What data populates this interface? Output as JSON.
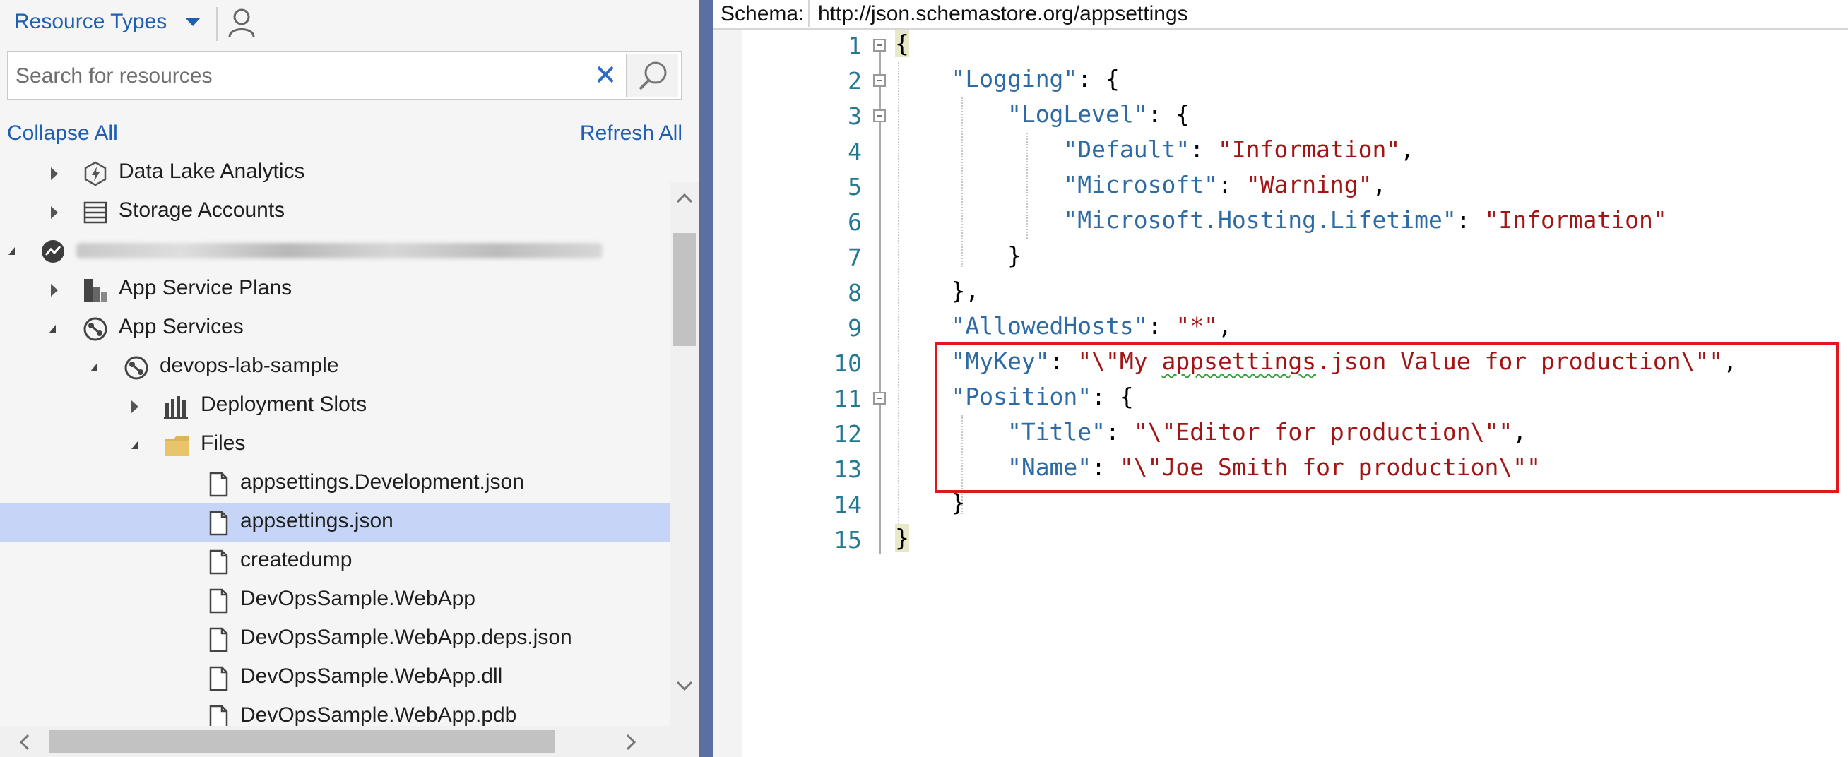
{
  "explorer": {
    "title": "Resource Types",
    "search_placeholder": "Search for resources",
    "collapse_all": "Collapse All",
    "refresh_all": "Refresh All",
    "tree": [
      {
        "label": "Data Lake Analytics",
        "icon": "data-lake-analytics-icon"
      },
      {
        "label": "Storage Accounts",
        "icon": "storage-accounts-icon"
      },
      {
        "label": "",
        "icon": "subscription-icon"
      },
      {
        "label": "App Service Plans",
        "icon": "app-service-plans-icon"
      },
      {
        "label": "App Services",
        "icon": "app-services-icon"
      },
      {
        "label": "devops-lab-sample",
        "icon": "web-app-icon"
      },
      {
        "label": "Deployment Slots",
        "icon": "deployment-slots-icon"
      },
      {
        "label": "Files",
        "icon": "folder-icon"
      },
      {
        "label": "appsettings.Development.json",
        "icon": "file-icon"
      },
      {
        "label": "appsettings.json",
        "icon": "file-icon",
        "selected": true
      },
      {
        "label": "createdump",
        "icon": "file-icon"
      },
      {
        "label": "DevOpsSample.WebApp",
        "icon": "file-icon"
      },
      {
        "label": "DevOpsSample.WebApp.deps.json",
        "icon": "file-icon"
      },
      {
        "label": "DevOpsSample.WebApp.dll",
        "icon": "file-icon"
      },
      {
        "label": "DevOpsSample.WebApp.pdb",
        "icon": "file-icon"
      }
    ]
  },
  "editor": {
    "schema_label": "Schema:",
    "schema_url": "http://json.schemastore.org/appsettings",
    "line_numbers": [
      "1",
      "2",
      "3",
      "4",
      "5",
      "6",
      "7",
      "8",
      "9",
      "10",
      "11",
      "12",
      "13",
      "14",
      "15"
    ],
    "code": {
      "l1_brace": "{",
      "l2_key": "\"Logging\"",
      "l2_rest": ": {",
      "l3_key": "\"LogLevel\"",
      "l3_rest": ": {",
      "l4_key": "\"Default\"",
      "l4_colon": ": ",
      "l4_val": "\"Information\"",
      "l4_comma": ",",
      "l5_key": "\"Microsoft\"",
      "l5_colon": ": ",
      "l5_val": "\"Warning\"",
      "l5_comma": ",",
      "l6_key": "\"Microsoft.Hosting.Lifetime\"",
      "l6_colon": ": ",
      "l6_val": "\"Information\"",
      "l7_brace": "}",
      "l8_brace": "},",
      "l9_key": "\"AllowedHosts\"",
      "l9_colon": ": ",
      "l9_val": "\"*\"",
      "l9_comma": ",",
      "l10_key": "\"MyKey\"",
      "l10_colon": ": ",
      "l10_val_a": "\"\\\"My ",
      "l10_val_b": "appsettings",
      "l10_val_c": ".json Value for production\\\"\"",
      "l10_comma": ",",
      "l11_key": "\"Position\"",
      "l11_rest": ": {",
      "l12_key": "\"Title\"",
      "l12_colon": ": ",
      "l12_val": "\"\\\"Editor for production\\\"\"",
      "l12_comma": ",",
      "l13_key": "\"Name\"",
      "l13_colon": ": ",
      "l13_val": "\"\\\"Joe Smith for production\\\"\"",
      "l14_brace": "}",
      "l15_brace": "}"
    }
  },
  "colors": {
    "accent": "#1e5fb4",
    "selection": "#c6d5f7",
    "json_key": "#2e6aa3",
    "json_string": "#a31515",
    "line_number": "#237893",
    "highlight_box": "#e0181c"
  }
}
